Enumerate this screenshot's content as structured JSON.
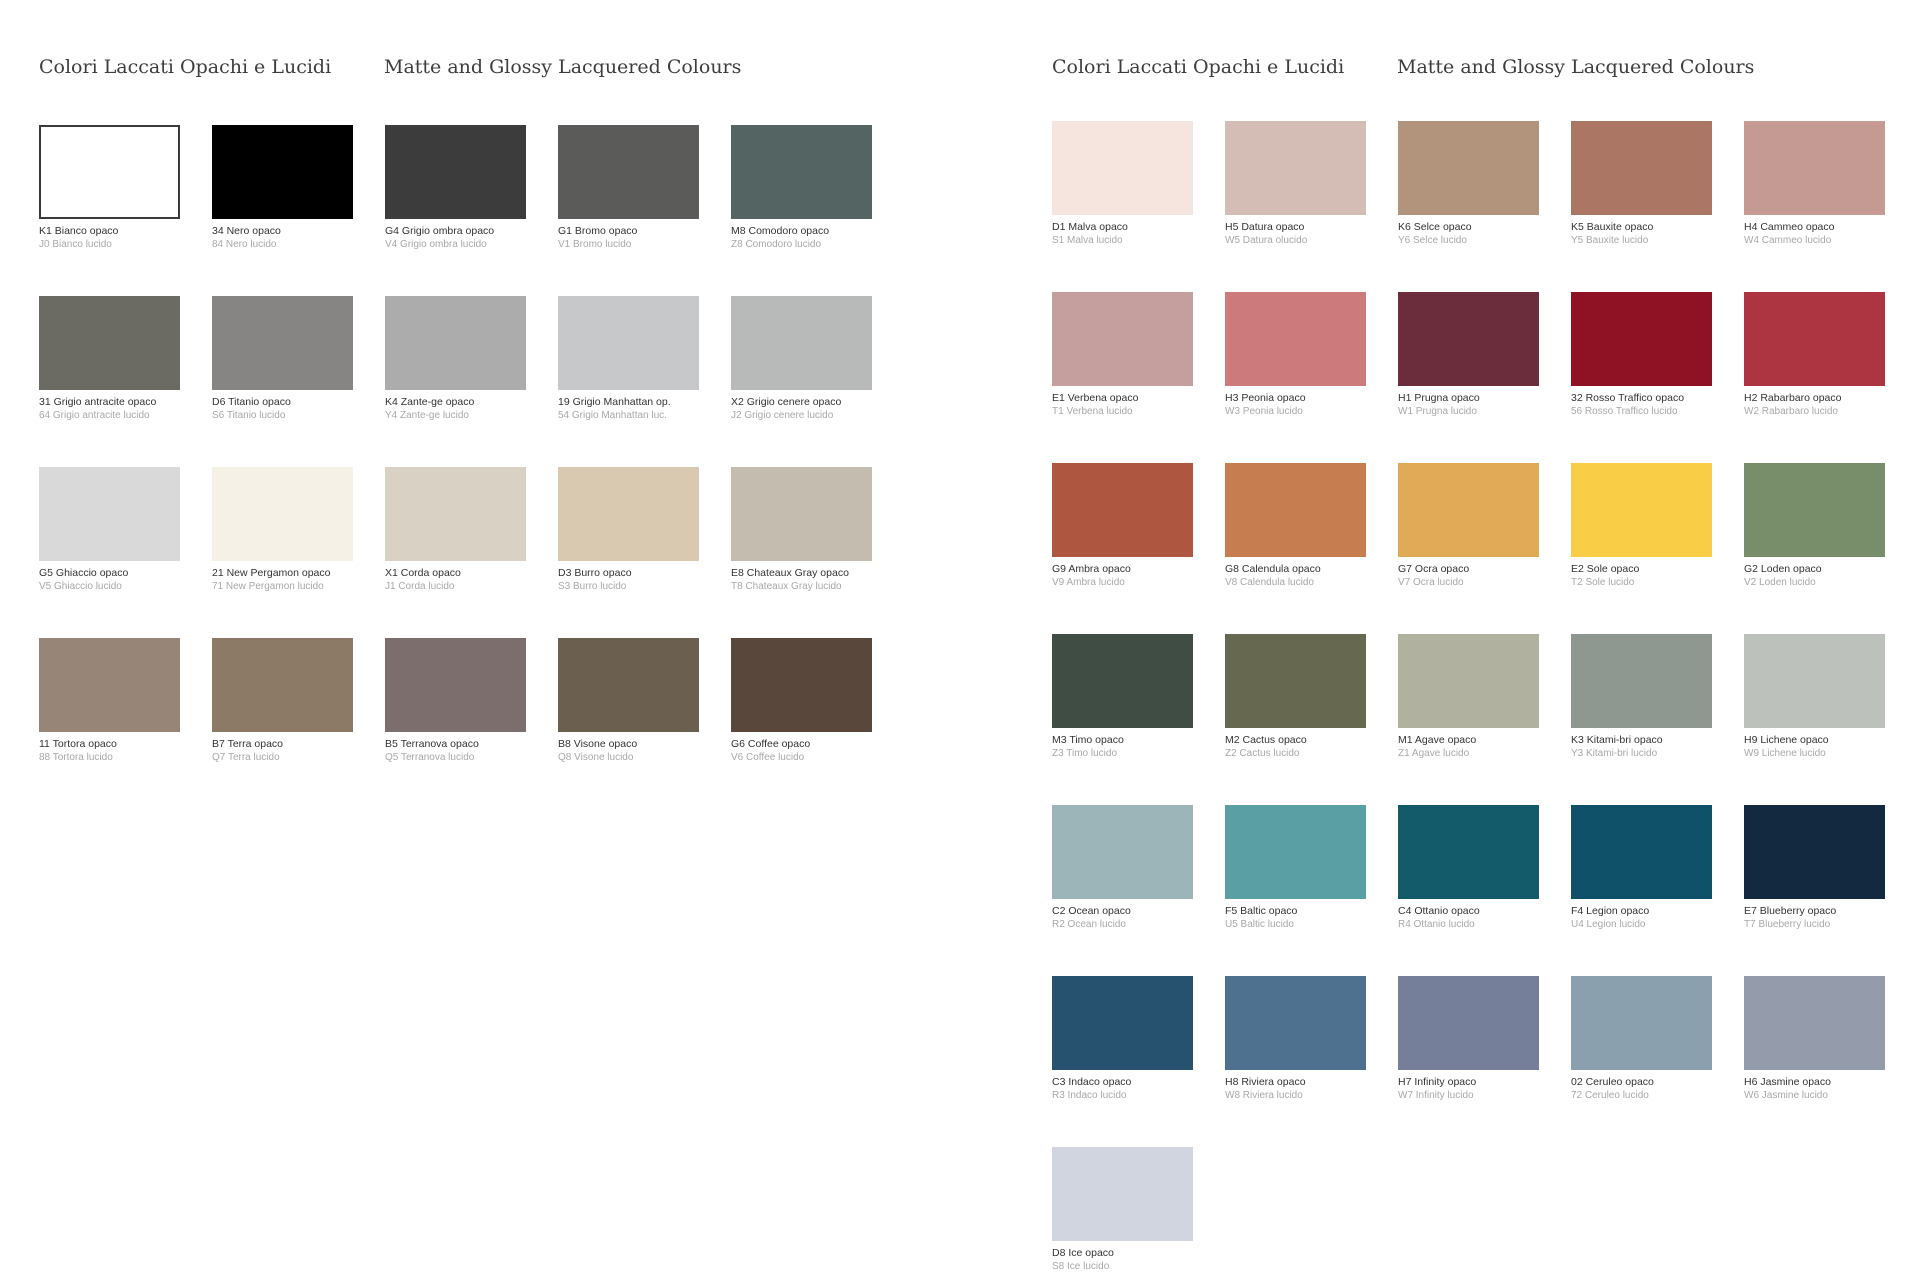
{
  "left": {
    "title_it": "Colori Laccati Opachi e Lucidi",
    "title_en": "Matte and Glossy Lacquered Colours",
    "swatches": [
      {
        "opaque": "K1 Bianco opaco",
        "glossy": "J0 Bianco lucido",
        "color": "#ffffff",
        "outlined": true
      },
      {
        "opaque": "34 Nero opaco",
        "glossy": "84 Nero lucido",
        "color": "#000000"
      },
      {
        "opaque": "G4 Grigio ombra opaco",
        "glossy": "V4 Grigio ombra lucido",
        "color": "#3c3c3c"
      },
      {
        "opaque": "G1 Bromo opaco",
        "glossy": "V1 Bromo lucido",
        "color": "#5b5b59"
      },
      {
        "opaque": "M8 Comodoro opaco",
        "glossy": "Z8 Comodoro lucido",
        "color": "#546462"
      },
      {
        "opaque": "31 Grigio antracite opaco",
        "glossy": "64 Grigio antracite lucido",
        "color": "#6b6b63"
      },
      {
        "opaque": "D6 Titanio opaco",
        "glossy": "S6 Titanio lucido",
        "color": "#878583"
      },
      {
        "opaque": "K4 Zante-ge opaco",
        "glossy": "Y4 Zante-ge lucido",
        "color": "#abacab"
      },
      {
        "opaque": "19 Grigio Manhattan op.",
        "glossy": "54 Grigio Manhattan luc.",
        "color": "#c7c8c9"
      },
      {
        "opaque": "X2 Grigio cenere opaco",
        "glossy": "J2 Grigio cenere lucido",
        "color": "#b7bab9"
      },
      {
        "opaque": "G5 Ghiaccio opaco",
        "glossy": "V5 Ghiaccio lucido",
        "color": "#d9d9d9"
      },
      {
        "opaque": "21 New Pergamon opaco",
        "glossy": "71 New Pergamon lucido",
        "color": "#f6f1e6"
      },
      {
        "opaque": "X1 Corda opaco",
        "glossy": "J1 Corda lucido",
        "color": "#d8d1c4"
      },
      {
        "opaque": "D3 Burro opaco",
        "glossy": "S3 Burro lucido",
        "color": "#d9c9b0"
      },
      {
        "opaque": "E8 Chateaux Gray opaco",
        "glossy": "T8 Chateaux Gray lucido",
        "color": "#c5bcb0"
      },
      {
        "opaque": "11 Tortora opaco",
        "glossy": "88 Tortora lucido",
        "color": "#978677"
      },
      {
        "opaque": "B7 Terra opaco",
        "glossy": "Q7 Terra lucido",
        "color": "#8c7a66"
      },
      {
        "opaque": "B5 Terranova opaco",
        "glossy": "Q5 Terranova lucido",
        "color": "#7c6e6c"
      },
      {
        "opaque": "B8 Visone opaco",
        "glossy": "Q8 Visone lucido",
        "color": "#6b5f50"
      },
      {
        "opaque": "G6 Coffee opaco",
        "glossy": "V6 Coffee lucido",
        "color": "#5a473c"
      }
    ]
  },
  "right": {
    "title_it": "Colori Laccati Opachi e Lucidi",
    "title_en": "Matte and Glossy Lacquered Colours",
    "swatches": [
      {
        "opaque": "D1 Malva opaco",
        "glossy": "S1 Malva lucido",
        "color": "#f6e5df"
      },
      {
        "opaque": "H5 Datura opaco",
        "glossy": "W5 Datura olucido",
        "color": "#d3bdb5"
      },
      {
        "opaque": "K6 Selce opaco",
        "glossy": "Y6 Selce lucido",
        "color": "#b2937b"
      },
      {
        "opaque": "K5 Bauxite opaco",
        "glossy": "Y5 Bauxite lucido",
        "color": "#ab7663"
      },
      {
        "opaque": "H4 Cammeo opaco",
        "glossy": "W4 Cammeo lucido",
        "color": "#c59a92"
      },
      {
        "opaque": "E1 Verbena opaco",
        "glossy": "T1 Verbena lucido",
        "color": "#c59f9d"
      },
      {
        "opaque": "H3 Peonia opaco",
        "glossy": "W3 Peonia lucido",
        "color": "#cc7a7c"
      },
      {
        "opaque": "H1 Prugna opaco",
        "glossy": "W1 Prugna lucido",
        "color": "#6b2d3c"
      },
      {
        "opaque": "32 Rosso Traffico opaco",
        "glossy": "56 Rosso Traffico lucido",
        "color": "#8f1124"
      },
      {
        "opaque": "H2 Rabarbaro opaco",
        "glossy": "W2 Rabarbaro lucido",
        "color": "#ad3441"
      },
      {
        "opaque": "G9 Ambra opaco",
        "glossy": "V9 Ambra lucido",
        "color": "#af5640"
      },
      {
        "opaque": "G8 Calendula opaco",
        "glossy": "V8 Calendula lucido",
        "color": "#c67e51"
      },
      {
        "opaque": "G7 Ocra opaco",
        "glossy": "V7 Ocra lucido",
        "color": "#e0aa57"
      },
      {
        "opaque": "E2 Sole opaco",
        "glossy": "T2 Sole lucido",
        "color": "#f9cd45"
      },
      {
        "opaque": "G2 Loden opaco",
        "glossy": "V2 Loden lucido",
        "color": "#788e6b"
      },
      {
        "opaque": "M3 Timo opaco",
        "glossy": "Z3 Timo lucido",
        "color": "#3f4d44"
      },
      {
        "opaque": "M2 Cactus opaco",
        "glossy": "Z2 Cactus lucido",
        "color": "#676850"
      },
      {
        "opaque": "M1 Agave opaco",
        "glossy": "Z1 Agave lucido",
        "color": "#b0b29f"
      },
      {
        "opaque": "K3 Kitami-bri opaco",
        "glossy": "Y3 Kitami-bri lucido",
        "color": "#8f9890"
      },
      {
        "opaque": "H9 Lichene opaco",
        "glossy": "W9 Lichene lucido",
        "color": "#bcc1bc"
      },
      {
        "opaque": "C2 Ocean opaco",
        "glossy": "R2 Ocean lucido",
        "color": "#9bb5b9"
      },
      {
        "opaque": "F5 Baltic opaco",
        "glossy": "U5 Baltic lucido",
        "color": "#5a9fa4"
      },
      {
        "opaque": "C4 Ottanio opaco",
        "glossy": "R4 Ottanio lucido",
        "color": "#135a6a"
      },
      {
        "opaque": "F4 Legion opaco",
        "glossy": "U4 Legion lucido",
        "color": "#10516a"
      },
      {
        "opaque": "E7 Blueberry opaco",
        "glossy": "T7 Blueberry lucido",
        "color": "#12293f"
      },
      {
        "opaque": "C3 Indaco opaco",
        "glossy": "R3 Indaco lucido",
        "color": "#26516f"
      },
      {
        "opaque": "H8 Riviera opaco",
        "glossy": "W8 Riviera lucido",
        "color": "#4e7190"
      },
      {
        "opaque": "H7 Infinity opaco",
        "glossy": "W7 Infinity lucido",
        "color": "#767f99"
      },
      {
        "opaque": "02 Ceruleo opaco",
        "glossy": "72 Ceruleo lucido",
        "color": "#8ba0ae"
      },
      {
        "opaque": "H6 Jasmine opaco",
        "glossy": "W6 Jasmine lucido",
        "color": "#949bab"
      },
      {
        "opaque": "D8 Ice opaco",
        "glossy": "S8 Ice lucido",
        "color": "#d0d5e0"
      }
    ]
  }
}
